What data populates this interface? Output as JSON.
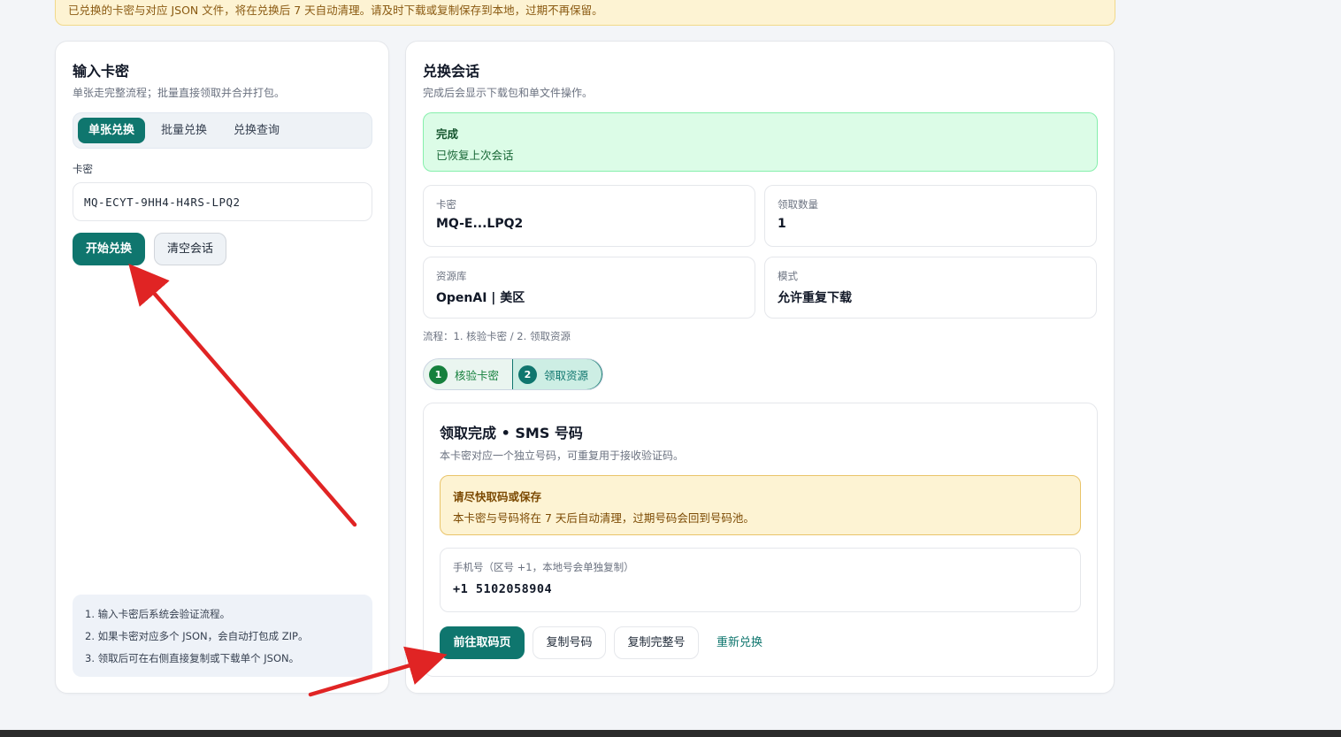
{
  "banner": {
    "text": "已兑换的卡密与对应 JSON 文件，将在兑换后 7 天自动清理。请及时下载或复制保存到本地，过期不再保留。"
  },
  "left": {
    "title": "输入卡密",
    "subtitle": "单张走完整流程；批量直接领取并合并打包。",
    "tabs": [
      {
        "label": "单张兑换",
        "active": true
      },
      {
        "label": "批量兑换",
        "active": false
      },
      {
        "label": "兑换查询",
        "active": false
      }
    ],
    "field_label": "卡密",
    "card_value": "MQ-ECYT-9HH4-H4RS-LPQ2",
    "start_button": "开始兑换",
    "clear_button": "清空会话",
    "tips": [
      "1. 输入卡密后系统会验证流程。",
      "2. 如果卡密对应多个 JSON，会自动打包成 ZIP。",
      "3. 领取后可在右侧直接复制或下载单个 JSON。"
    ]
  },
  "right": {
    "title": "兑换会话",
    "subtitle": "完成后会显示下载包和单文件操作。",
    "status": {
      "title": "完成",
      "text": "已恢复上次会话"
    },
    "info": {
      "card_label": "卡密",
      "card_value": "MQ-E...LPQ2",
      "count_label": "领取数量",
      "count_value": "1",
      "repo_label": "资源库",
      "repo_value": "OpenAI | 美区",
      "mode_label": "模式",
      "mode_value": "允许重复下载"
    },
    "flow_text": "流程：1. 核验卡密 / 2. 领取资源",
    "steps": [
      {
        "num": "1",
        "label": "核验卡密"
      },
      {
        "num": "2",
        "label": "领取资源"
      }
    ],
    "result": {
      "title": "领取完成 • SMS 号码",
      "subtitle": "本卡密对应一个独立号码，可重复用于接收验证码。",
      "warn_title": "请尽快取码或保存",
      "warn_text": "本卡密与号码将在 7 天后自动清理，过期号码会回到号码池。",
      "phone_label": "手机号（区号 +1，本地号会单独复制）",
      "phone_value": "+1 5102058904",
      "btn_goto": "前往取码页",
      "btn_copy_number": "复制号码",
      "btn_copy_full": "复制完整号",
      "btn_reset": "重新兑换"
    }
  },
  "colors": {
    "primary": "#0f766e",
    "success_bg": "#dcfce7",
    "warn_bg": "#fdf3d3",
    "arrow": "#e02424"
  }
}
